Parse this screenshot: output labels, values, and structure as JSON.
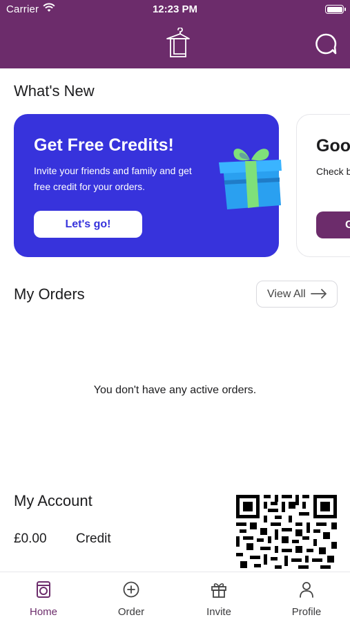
{
  "status_bar": {
    "carrier": "Carrier",
    "time": "12:23 PM"
  },
  "header": {
    "logo_icon": "hanger-icon",
    "chat_icon": "chat-bubble-icon"
  },
  "whats_new": {
    "title": "What's New",
    "promo": {
      "title": "Get Free Credits!",
      "text": "Invite your friends and family and get free credit for your orders.",
      "button": "Let's go!",
      "icon": "gift-icon"
    },
    "next_card": {
      "title": "Goo",
      "text": "Check b and info",
      "button": "G"
    }
  },
  "orders": {
    "title": "My Orders",
    "view_all": "View All",
    "empty_message": "You don't have any active orders."
  },
  "account": {
    "title": "My Account",
    "credit_amount": "£0.00",
    "credit_label": "Credit",
    "qr_icon": "qr-code-icon"
  },
  "tabbar": {
    "tabs": [
      {
        "label": "Home",
        "icon": "washing-machine-icon",
        "active": true
      },
      {
        "label": "Order",
        "icon": "plus-circle-icon",
        "active": false
      },
      {
        "label": "Invite",
        "icon": "gift-icon",
        "active": false
      },
      {
        "label": "Profile",
        "icon": "person-icon",
        "active": false
      }
    ]
  },
  "colors": {
    "brand_purple": "#6c2c6b",
    "promo_blue": "#3733dc",
    "gift_blue": "#2aa0f0",
    "gift_ribbon": "#7fe07a"
  }
}
